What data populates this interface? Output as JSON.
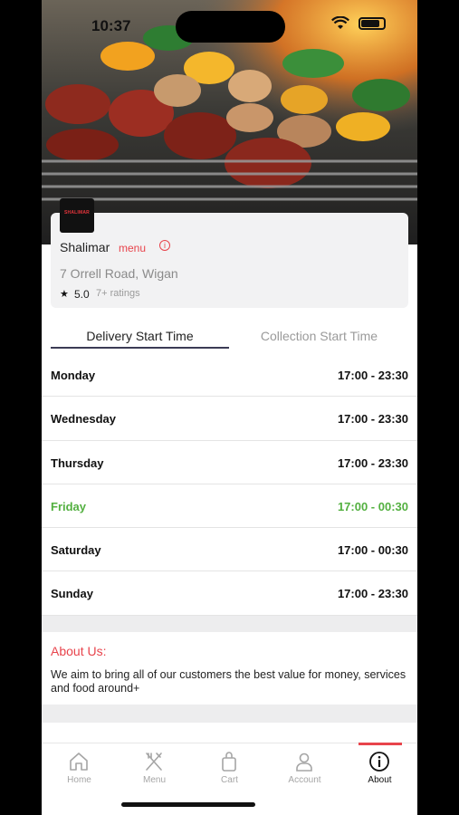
{
  "status_bar": {
    "time": "10:37"
  },
  "restaurant": {
    "logo_text": "SHALIMAR",
    "name": "Shalimar",
    "menu_link": "menu",
    "info_icon": "info-icon",
    "address": "7 Orrell Road, Wigan",
    "rating": "5.0",
    "ratings_count": "7+ ratings"
  },
  "tabs": [
    {
      "label": "Delivery Start Time",
      "selected": true
    },
    {
      "label": "Collection Start Time",
      "selected": false
    }
  ],
  "schedule": [
    {
      "day": "Monday",
      "hours": "17:00 - 23:30",
      "today": false
    },
    {
      "day": "Wednesday",
      "hours": "17:00 - 23:30",
      "today": false
    },
    {
      "day": "Thursday",
      "hours": "17:00 - 23:30",
      "today": false
    },
    {
      "day": "Friday",
      "hours": "17:00 - 00:30",
      "today": true
    },
    {
      "day": "Saturday",
      "hours": "17:00 - 00:30",
      "today": false
    },
    {
      "day": "Sunday",
      "hours": "17:00 - 23:30",
      "today": false
    }
  ],
  "about": {
    "title": "About Us:",
    "text": "We aim to bring all of our customers the best value for money, services and food around+"
  },
  "tab_bar": [
    {
      "label": "Home",
      "icon": "home-icon",
      "active": false
    },
    {
      "label": "Menu",
      "icon": "fork-knife-icon",
      "active": false
    },
    {
      "label": "Cart",
      "icon": "shopping-bag-icon",
      "active": false
    },
    {
      "label": "Account",
      "icon": "person-icon",
      "active": false
    },
    {
      "label": "About",
      "icon": "info-circle-icon",
      "active": true
    }
  ],
  "colors": {
    "accent": "#e8444c",
    "today": "#53b040",
    "tab_underline": "#3b3b55"
  }
}
